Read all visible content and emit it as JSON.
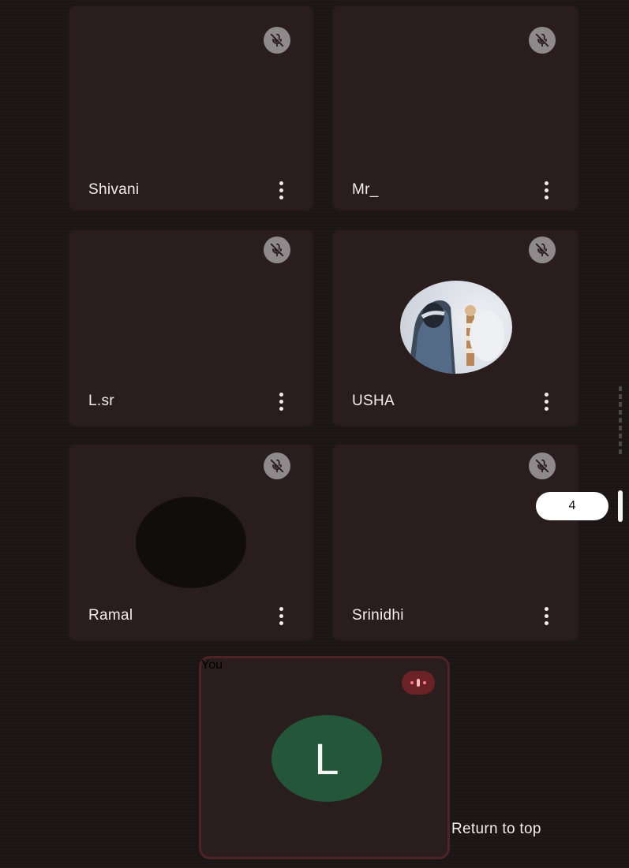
{
  "participants": [
    {
      "name": "Shivani",
      "muted": true,
      "avatar": "none"
    },
    {
      "name": "Mr_",
      "muted": true,
      "avatar": "none"
    },
    {
      "name": "L.sr",
      "muted": true,
      "avatar": "none"
    },
    {
      "name": "USHA",
      "muted": true,
      "avatar": "photo"
    },
    {
      "name": "Ramal",
      "muted": true,
      "avatar": "dark-circle"
    },
    {
      "name": "Srinidhi",
      "muted": true,
      "avatar": "none"
    }
  ],
  "self": {
    "name": "You",
    "avatar_letter": "L",
    "avatar_color": "#24563a",
    "speaking_indicator": "audio-level-icon"
  },
  "return_to_top": "Return to top",
  "scroll": {
    "page_indicator": "4"
  },
  "icons": {
    "mute": "mic-off-icon",
    "more": "more-vert-icon"
  },
  "colors": {
    "tile_background": "#2a1d1d",
    "mute_badge": "#8e8a8c",
    "self_border": "#4d2326"
  }
}
